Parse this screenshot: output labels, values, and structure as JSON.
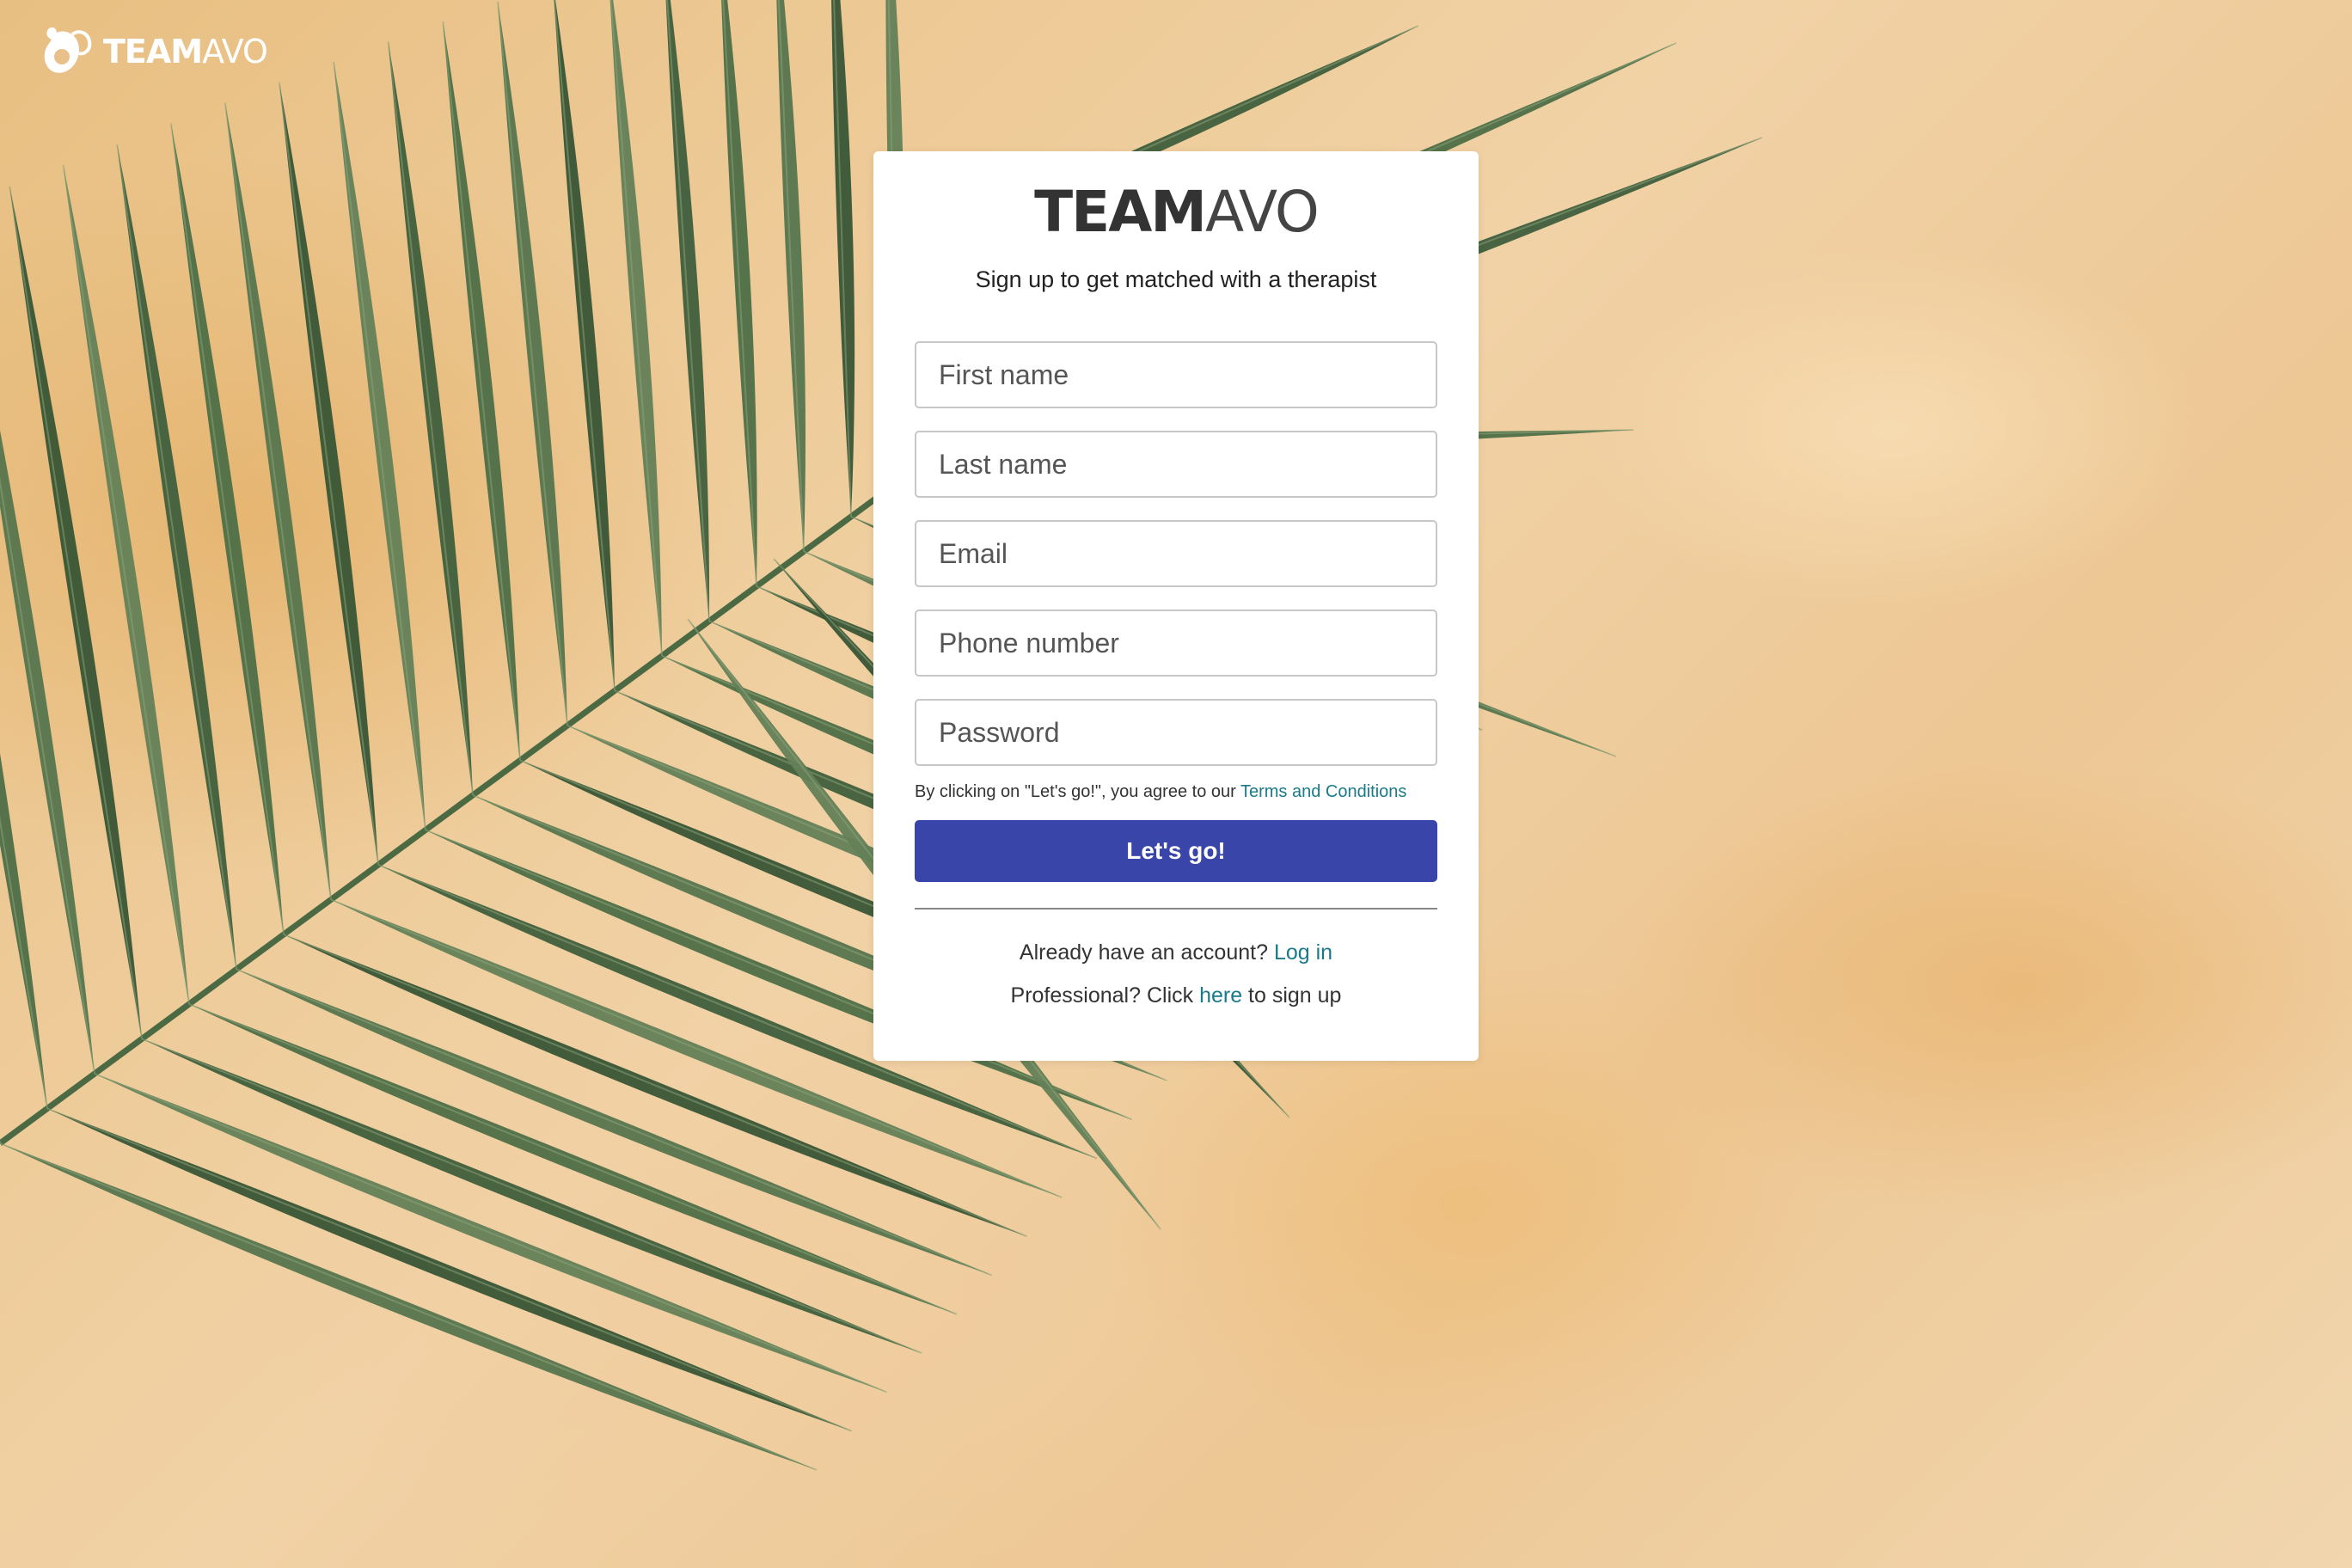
{
  "brand": {
    "logo_strong": "TEAM",
    "logo_light": "AVO"
  },
  "card": {
    "logo_strong": "TEAM",
    "logo_light": "AVO",
    "subtitle": "Sign up to get matched with a therapist"
  },
  "form": {
    "first_name_placeholder": "First name",
    "last_name_placeholder": "Last name",
    "email_placeholder": "Email",
    "phone_placeholder": "Phone number",
    "password_placeholder": "Password",
    "terms_prefix": "By clicking on \"Let's go!\", you agree to our ",
    "terms_link": "Terms and Conditions",
    "submit_label": "Let's go!"
  },
  "footer": {
    "account_prefix": "Already have an account? ",
    "login_link": "Log in",
    "pro_prefix": "Professional? Click ",
    "pro_link": "here",
    "pro_suffix": " to sign up"
  },
  "colors": {
    "primary_button": "#3a45aa",
    "link": "#1a7a8a",
    "card_bg": "#ffffff"
  },
  "icons": {
    "brand_icon": "avocado-icon"
  }
}
